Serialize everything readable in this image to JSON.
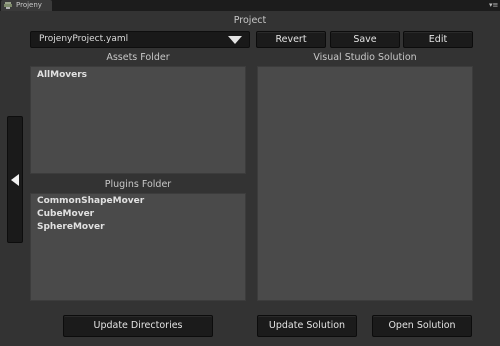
{
  "window": {
    "tab_label": "Projeny",
    "tab_icon": "projeny-logo-icon",
    "menu_icon": "window-menu-icon"
  },
  "header": {
    "title": "Project",
    "project_select": {
      "value": "ProjenyProject.yaml"
    },
    "revert_label": "Revert",
    "save_label": "Save",
    "edit_label": "Edit"
  },
  "assets": {
    "heading": "Assets Folder",
    "items": [
      "AllMovers"
    ]
  },
  "plugins": {
    "heading": "Plugins Folder",
    "items": [
      "CommonShapeMover",
      "CubeMover",
      "SphereMover"
    ]
  },
  "solution": {
    "heading": "Visual Studio Solution",
    "items": []
  },
  "footer": {
    "update_directories_label": "Update Directories",
    "update_solution_label": "Update Solution",
    "open_solution_label": "Open Solution"
  },
  "colors": {
    "background": "#333333",
    "panel": "#4a4a4a",
    "button": "#1b1b1b",
    "text": "#e1e1e1"
  }
}
